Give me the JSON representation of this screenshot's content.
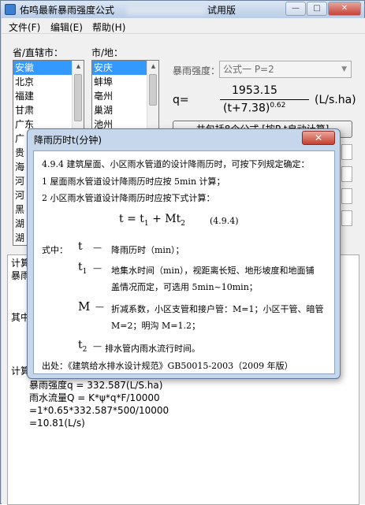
{
  "window": {
    "title": "佑鸣最新暴雨强度公式",
    "title_suffix": "试用版",
    "min_btn": "—",
    "max_btn": "□",
    "close_btn": "✕"
  },
  "menu": [
    "文件(F)",
    "编辑(E)",
    "帮助(H)"
  ],
  "province": {
    "label": "省/直辖市：",
    "items": [
      "安徽",
      "北京",
      "福建",
      "甘肃",
      "广东",
      "广",
      "贵",
      "海",
      "河",
      "河",
      "黑",
      "湖",
      "湖"
    ]
  },
  "city": {
    "label": "市/地：",
    "items": [
      "安庆",
      "蚌埠",
      "亳州",
      "巢湖",
      "池州"
    ]
  },
  "formula": {
    "label": "暴雨强度：",
    "selected": "公式一 P=2",
    "lhs": "q=",
    "numerator": "1953.15",
    "denominator_base": "(t+7.38)",
    "denominator_exp": "0.62",
    "unit": "(L/s.ha)"
  },
  "calc_button": "共包括8个公式 [按P,t自动计算]",
  "result": {
    "line0": "计算",
    "line1": "暴雨",
    "line2": "其中",
    "line3": "计算",
    "lines": [
      "暴雨强度q = 332.587(L/S.ha)",
      "雨水流量Q = K*ψ*q*F/10000",
      "=1*0.65*332.587*500/10000",
      "=10.81(L/s)"
    ]
  },
  "dialog": {
    "title": "降雨历时t(分钟)",
    "close": "✕",
    "p1": "4.9.4 建筑屋面、小区雨水管道的设计降雨历时，可按下列规定确定：",
    "p2": "1 屋面雨水管道设计降雨历时应按 5min 计算；",
    "p3": "2 小区雨水管道设计降雨历时应按下式计算：",
    "eq_lhs": "t = t",
    "eq_sub1": "1",
    "eq_mid": " + Mt",
    "eq_sub2": "2",
    "eq_no": "(4.9.4)",
    "where": "式中：",
    "sym_t": "t",
    "dash": "—",
    "desc_t": "降雨历时（min）；",
    "sym_t1": "t",
    "sub_1": "1",
    "desc_t1a": "地集水时间（min），视距离长短、地形坡度和地面铺",
    "desc_t1b": "盖情况而定，可选用 5min~10min；",
    "sym_M": "M",
    "desc_Ma": "折减系数，小区支管和接户管：M=1；小区干管、暗管",
    "desc_Mb": "M=2；明沟 M=1.2；",
    "sym_t2": "t",
    "sub_2": "2",
    "desc_t2": "排水管内雨水流行时间。",
    "source": "出处：《建筑给水排水设计规范》GB50015-2003（2009 年版）"
  }
}
